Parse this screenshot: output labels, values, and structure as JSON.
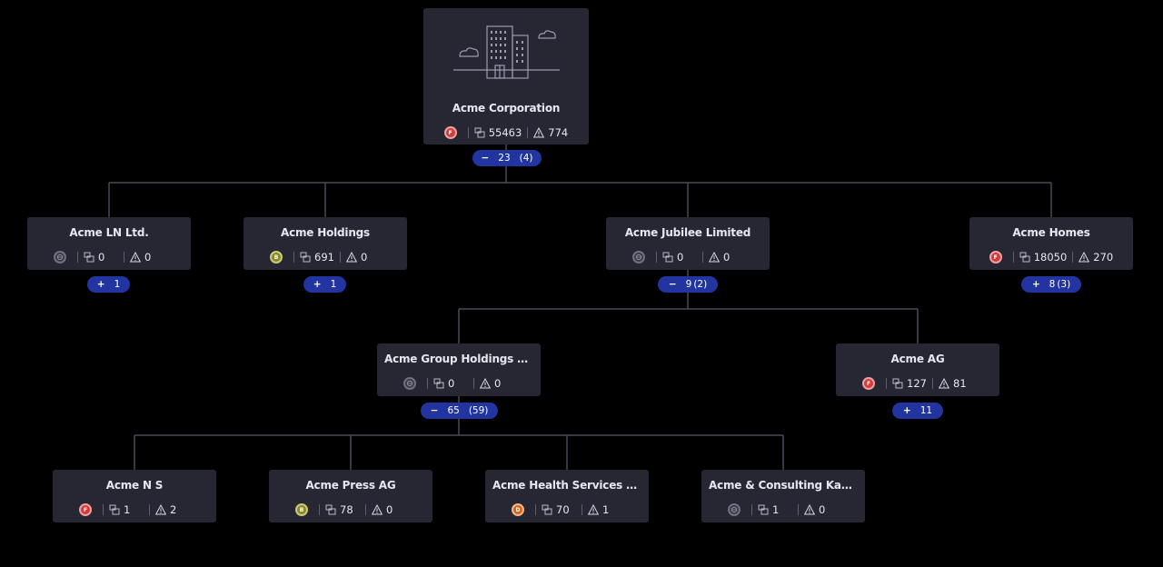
{
  "colors": {
    "background": "#000000",
    "card": "#262733",
    "pill": "#2234a0",
    "line": "#4a4b58",
    "grade_f": "#d33c3c",
    "grade_b": "#8a8a28",
    "grade_d": "#d2651e",
    "grade_none": "#6f7080"
  },
  "nodes": [
    {
      "id": "root",
      "name": "Acme Corporation",
      "grade": "F",
      "grade_icon": "grade-f-badge",
      "assets": "55463",
      "issues": "774",
      "toggle": "−",
      "count": "23",
      "sub": "(4)"
    },
    {
      "id": "ln",
      "name": "Acme LN Ltd.",
      "grade": "",
      "grade_icon": "grade-none-badge",
      "assets": "0",
      "issues": "0",
      "toggle": "+",
      "count": "1",
      "sub": ""
    },
    {
      "id": "holdings",
      "name": "Acme Holdings",
      "grade": "B",
      "grade_icon": "grade-b-badge",
      "assets": "691",
      "issues": "0",
      "toggle": "+",
      "count": "1",
      "sub": ""
    },
    {
      "id": "jubilee",
      "name": "Acme Jubilee Limited",
      "grade": "",
      "grade_icon": "grade-none-badge",
      "assets": "0",
      "issues": "0",
      "toggle": "−",
      "count": "9",
      "sub": "(2)"
    },
    {
      "id": "homes",
      "name": "Acme Homes",
      "grade": "F",
      "grade_icon": "grade-f-badge",
      "assets": "18050",
      "issues": "270",
      "toggle": "+",
      "count": "8",
      "sub": "(3)"
    },
    {
      "id": "group",
      "name": "Acme Group Holdings Li...",
      "grade": "",
      "grade_icon": "grade-none-badge",
      "assets": "0",
      "issues": "0",
      "toggle": "−",
      "count": "65",
      "sub": "(59)"
    },
    {
      "id": "ag",
      "name": "Acme AG",
      "grade": "F",
      "grade_icon": "grade-f-badge",
      "assets": "127",
      "issues": "81",
      "toggle": "+",
      "count": "11",
      "sub": ""
    },
    {
      "id": "ns",
      "name": "Acme N S",
      "grade": "F",
      "grade_icon": "grade-f-badge",
      "assets": "1",
      "issues": "2"
    },
    {
      "id": "press",
      "name": "Acme Press AG",
      "grade": "B",
      "grade_icon": "grade-b-badge",
      "assets": "78",
      "issues": "0"
    },
    {
      "id": "health",
      "name": "Acme Health Services Gmbh",
      "grade": "D",
      "grade_icon": "grade-d-badge",
      "assets": "70",
      "issues": "1"
    },
    {
      "id": "consult",
      "name": "Acme & Consulting Kant...",
      "grade": "",
      "grade_icon": "grade-none-badge",
      "assets": "1",
      "issues": "0"
    }
  ],
  "edges": [
    [
      "root",
      "ln"
    ],
    [
      "root",
      "holdings"
    ],
    [
      "root",
      "jubilee"
    ],
    [
      "root",
      "homes"
    ],
    [
      "jubilee",
      "group"
    ],
    [
      "jubilee",
      "ag"
    ],
    [
      "group",
      "ns"
    ],
    [
      "group",
      "press"
    ],
    [
      "group",
      "health"
    ],
    [
      "group",
      "consult"
    ]
  ]
}
